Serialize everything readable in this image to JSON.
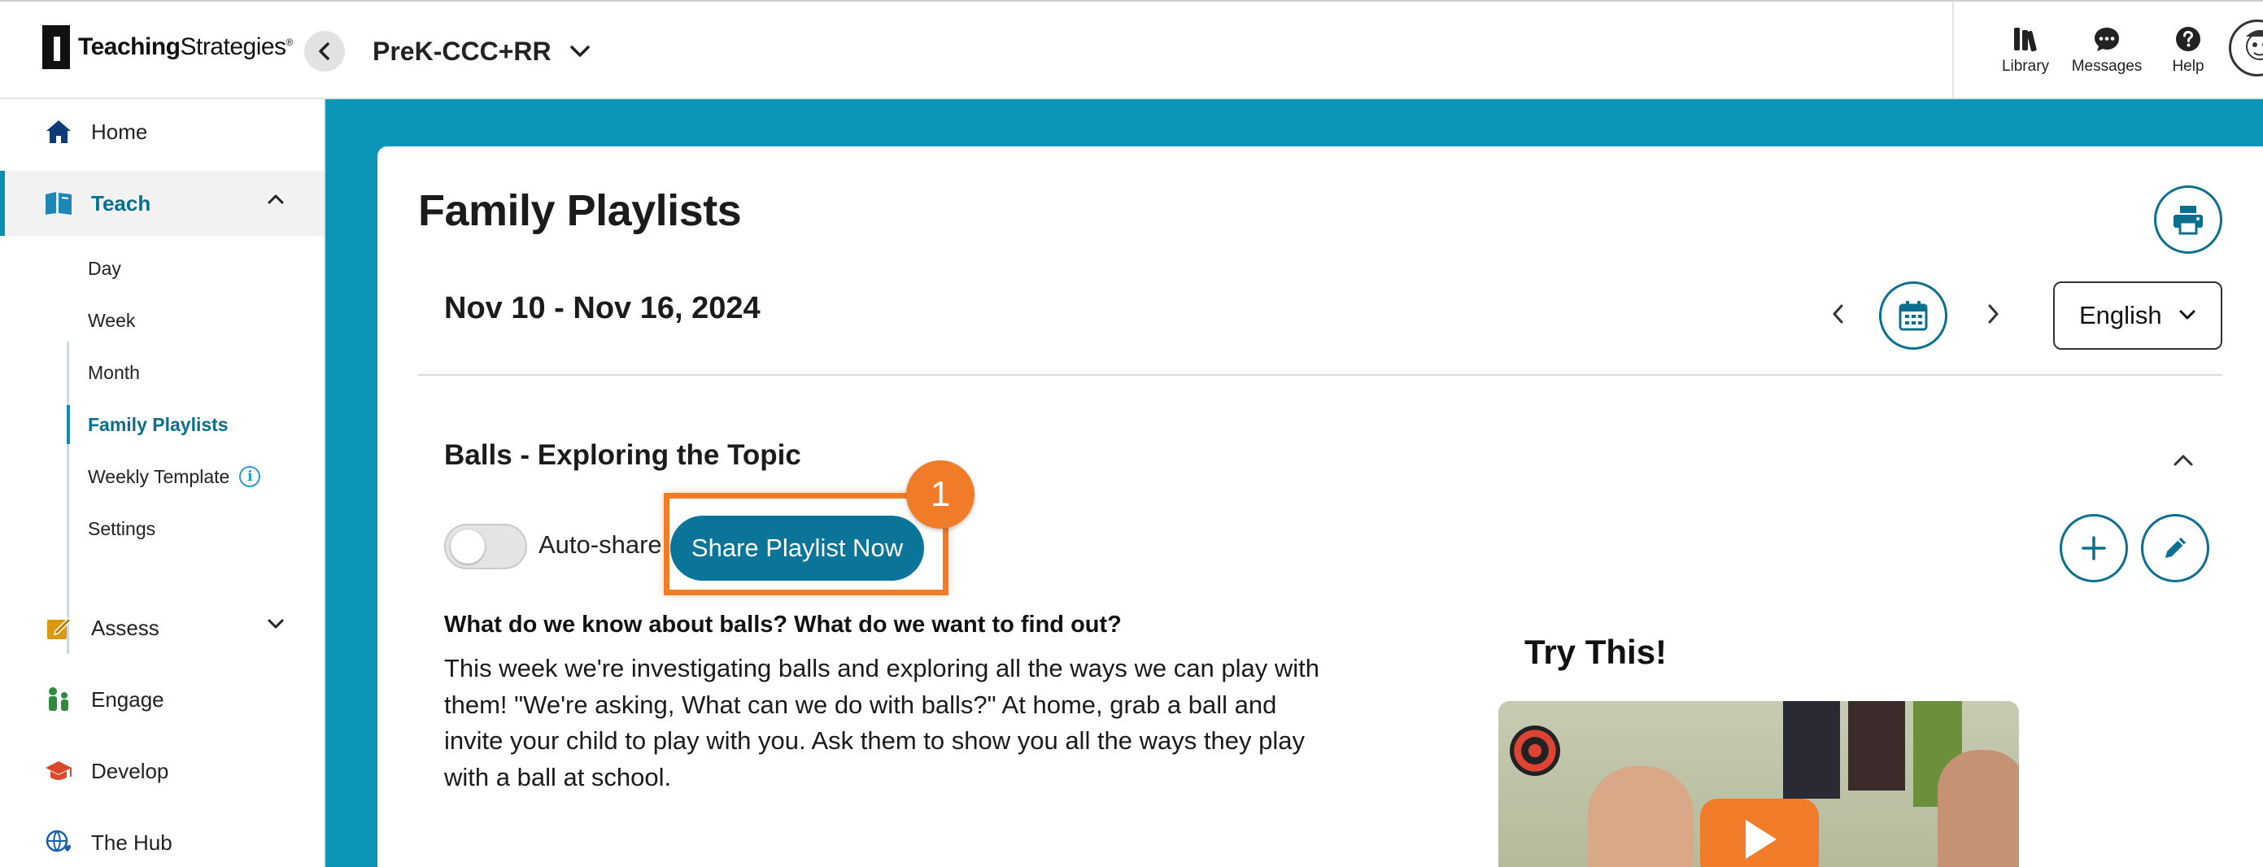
{
  "header": {
    "logo_bold": "Teaching",
    "logo_regular": "Strategies",
    "logo_mark": "®",
    "program": "PreK-CCC+RR",
    "tools": [
      {
        "label": "Library",
        "icon": "library-icon"
      },
      {
        "label": "Messages",
        "icon": "messages-icon"
      },
      {
        "label": "Help",
        "icon": "help-icon"
      }
    ]
  },
  "sidebar": {
    "items": [
      {
        "label": "Home",
        "icon": "home-icon"
      },
      {
        "label": "Teach",
        "icon": "book-icon",
        "expanded": true
      },
      {
        "label": "Assess",
        "icon": "assess-icon"
      },
      {
        "label": "Engage",
        "icon": "engage-icon"
      },
      {
        "label": "Develop",
        "icon": "graduation-cap-icon"
      },
      {
        "label": "The Hub",
        "icon": "globe-heart-icon"
      }
    ],
    "teach_sub": [
      {
        "label": "Day"
      },
      {
        "label": "Week"
      },
      {
        "label": "Month"
      },
      {
        "label": "Family Playlists",
        "active": true
      },
      {
        "label": "Weekly Template",
        "info": "i"
      },
      {
        "label": "Settings"
      }
    ]
  },
  "main": {
    "title": "Family Playlists",
    "date_range": "Nov 10 - Nov 16, 2024",
    "language": "English",
    "section": {
      "title": "Balls - Exploring the Topic",
      "autoshare_label": "Auto-share",
      "autoshare_on": false,
      "share_button": "Share Playlist Now",
      "step_number": "1",
      "question": "What do we know about balls? What do we want to find out?",
      "body": "This week we're investigating balls and exploring all the ways we can play with them! \"We're asking, What can we do with balls?\" At home, grab a ball and invite your child to play with you. Ask them to show you all the ways they play with a ball at school.",
      "try_title": "Try This!"
    }
  },
  "colors": {
    "accent": "#0a7499",
    "teal_bg": "#0b96b8",
    "highlight": "#f07c2a"
  }
}
